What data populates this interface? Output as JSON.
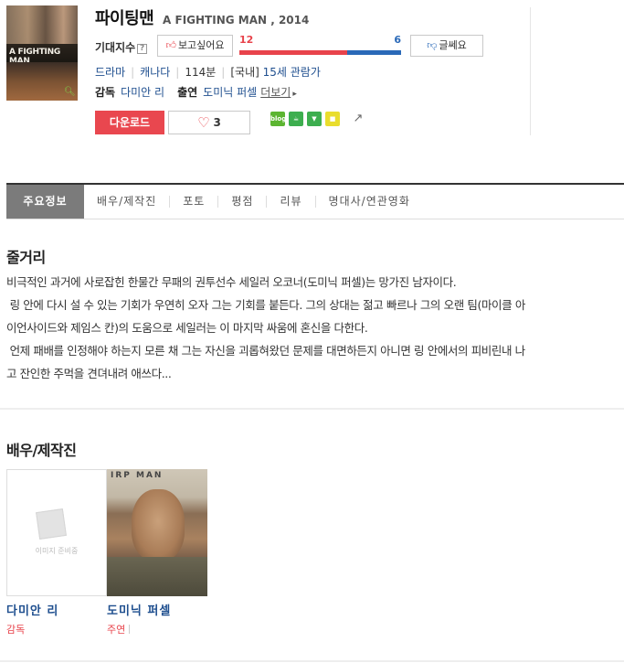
{
  "movie": {
    "title": "파이팅맨",
    "title_en": "A FIGHTING MAN , 2014",
    "poster_title": "A FIGHTING MAN"
  },
  "expectation": {
    "label": "기대지수",
    "help": "?",
    "like_label": "보고싶어요",
    "dislike_label": "글쎄요",
    "like_count": "12",
    "dislike_count": "6",
    "like_ratio": 0.667
  },
  "meta": {
    "genre": "드라마",
    "country": "캐나다",
    "runtime": "114분",
    "rating_prefix": "[국내]",
    "rating": "15세 관람가"
  },
  "credits": {
    "director_label": "감독",
    "director": "다미안 리",
    "cast_label": "출연",
    "cast": "도미닉 퍼셀",
    "more": "더보기"
  },
  "actions": {
    "download": "다운로드",
    "heart_count": "3",
    "share_blog": "blog"
  },
  "tabs": [
    {
      "label": "주요정보",
      "active": true
    },
    {
      "label": "배우/제작진"
    },
    {
      "label": "포토"
    },
    {
      "label": "평점"
    },
    {
      "label": "리뷰"
    },
    {
      "label": "명대사/연관영화"
    }
  ],
  "synopsis": {
    "heading": "줄거리",
    "lines": [
      "비극적인 과거에 사로잡힌 한물간 무패의 권투선수 세일러 오코너(도미닉 퍼셀)는 망가진 남자이다.",
      " 링 안에 다시 설 수 있는 기회가 우연히 오자 그는 기회를 붙든다. 그의 상대는 젊고 빠르나 그의 오랜 팀(마이클 아",
      "이언사이드와 제임스 칸)의 도움으로 세일러는 이 마지막 싸움에 혼신을 다한다.",
      " 언제 패배를 인정해야 하는지 모른 채 그는 자신을 괴롭혀왔던 문제를 대면하든지 아니면 링 안에서의 피비린내 나",
      "고 잔인한 주먹을 견뎌내려 애쓰다..."
    ]
  },
  "cast_section": {
    "heading": "배우/제작진",
    "placeholder_text": "이미지 준비중",
    "photo_sign": "IRP MAN",
    "people": [
      {
        "name": "다미안 리",
        "role": "감독"
      },
      {
        "name": "도미닉 퍼셀",
        "role": "주연"
      }
    ]
  },
  "colors": {
    "like": "#e8434b",
    "dislike": "#2a69b8",
    "download": "#e9474f",
    "link": "#1f4f8f"
  }
}
